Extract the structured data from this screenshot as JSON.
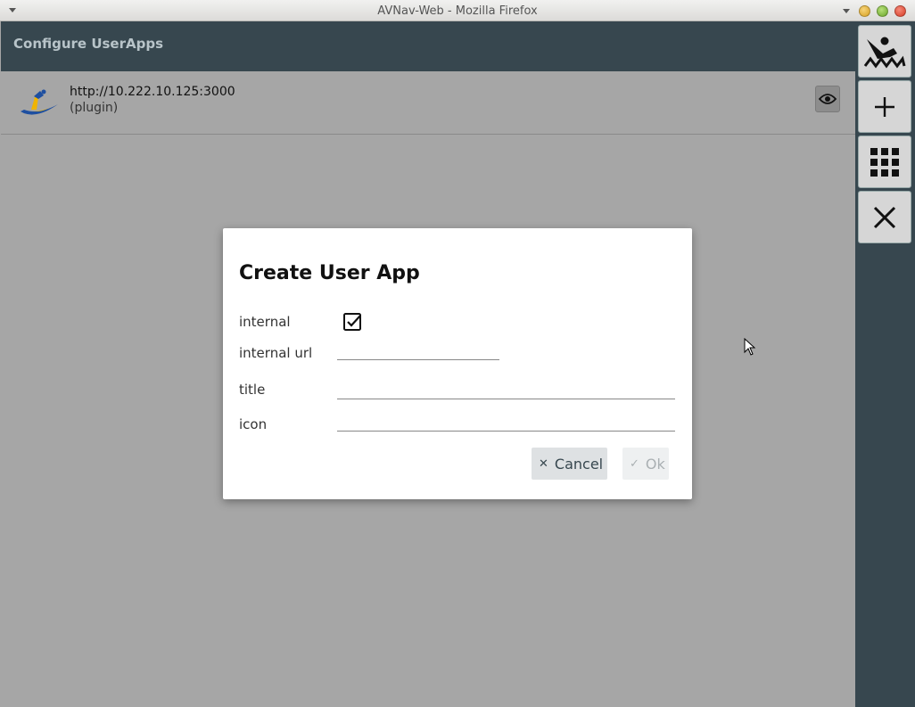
{
  "window": {
    "title": "AVNav-Web - Mozilla Firefox"
  },
  "header": {
    "title": "Configure UserApps"
  },
  "apps": [
    {
      "url": "http://10.222.10.125:3000",
      "kind": "(plugin)"
    }
  ],
  "dialog": {
    "title": "Create User App",
    "fields": {
      "internal": {
        "label": "internal",
        "checked": true
      },
      "internal_url": {
        "label": "internal url",
        "value": ""
      },
      "title": {
        "label": "title",
        "value": ""
      },
      "icon": {
        "label": "icon",
        "value": ""
      }
    },
    "cancel_label": "Cancel",
    "ok_label": "Ok"
  },
  "colors": {
    "header_bg": "#37474f",
    "page_bg": "#a6a6a6",
    "button_bg": "#d6d6d6"
  },
  "icons": [
    "menu-arrow-icon",
    "app-logo-icon",
    "eye-icon",
    "anchor-watch-icon",
    "plus-icon",
    "grid-icon",
    "close-icon",
    "checkbox-checked-icon",
    "cancel-x-icon",
    "ok-check-icon"
  ]
}
